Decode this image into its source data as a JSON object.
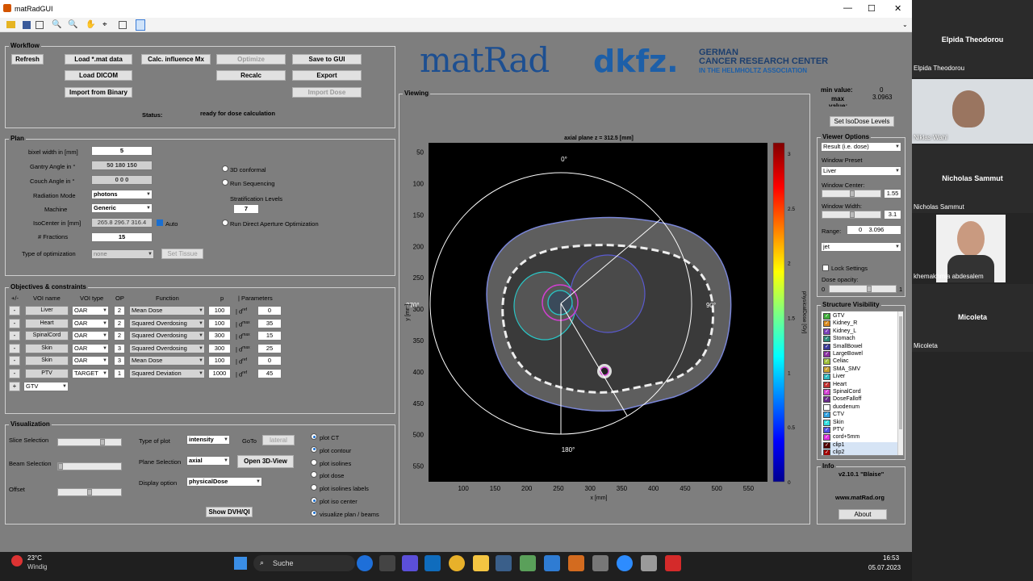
{
  "window": {
    "title": "matRadGUI",
    "minimize": "—",
    "maximize": "☐",
    "close": "✕"
  },
  "toolbar": {
    "icons": [
      "open-file-icon",
      "save-icon",
      "print-icon",
      "zoom-in-icon",
      "zoom-out-icon",
      "pan-icon",
      "data-cursor-icon",
      "grid-icon",
      "window-icon"
    ]
  },
  "workflow": {
    "title": "Workflow",
    "refresh": "Refresh",
    "load_mat": "Load *.mat data",
    "calc_influence": "Calc. influence Mx",
    "optimize": "Optimize",
    "save_gui": "Save to GUI",
    "load_dicom": "Load DICOM",
    "recalc": "Recalc",
    "export": "Export",
    "import_binary": "Import from Binary",
    "import_dose": "Import Dose",
    "status_label": "Status:",
    "status_value": "ready for dose calculation"
  },
  "logos": {
    "matrad": "matRad",
    "dkfz": "dkfz.",
    "dkfz_line1": "GERMAN",
    "dkfz_line2": "CANCER RESEARCH CENTER",
    "dkfz_line3": "IN THE HELMHOLTZ ASSOCIATION"
  },
  "plan": {
    "title": "Plan",
    "bixel_label": "bixel width in [mm]",
    "bixel_value": "5",
    "gantry_label": "Gantry Angle in °",
    "gantry_value": "50 180 150",
    "couch_label": "Couch Angle in °",
    "couch_value": "0 0 0",
    "radiation_label": "Radiation Mode",
    "radiation_value": "photons",
    "machine_label": "Machine",
    "machine_value": "Generic",
    "iso_label": "IsoCenter in [mm]",
    "iso_value": "265.8 296.7 316.4",
    "auto_label": "Auto",
    "fractions_label": "# Fractions",
    "fractions_value": "15",
    "opt_label": "Type of optimization",
    "opt_value": "none",
    "set_tissue": "Set Tissue",
    "conformal": "3D conformal",
    "sequencing": "Run Sequencing",
    "strat_label": "Stratification Levels",
    "strat_value": "7",
    "daopt": "Run Direct Aperture Optimization"
  },
  "objectives": {
    "title": "Objectives & constraints",
    "headers": {
      "pm": "+/-",
      "voi": "VOI name",
      "type": "VOI type",
      "op": "OP",
      "func": "Function",
      "p": "p",
      "params": "| Parameters"
    },
    "rows": [
      {
        "voi": "Liver",
        "type": "OAR",
        "op": "2",
        "func": "Mean Dose",
        "p": "100",
        "pl": "| d",
        "sup": "ref",
        "val": "0"
      },
      {
        "voi": "Heart",
        "type": "OAR",
        "op": "2",
        "func": "Squared Overdosing",
        "p": "100",
        "pl": "| d",
        "sup": "max",
        "val": "35"
      },
      {
        "voi": "SpinalCord",
        "type": "OAR",
        "op": "2",
        "func": "Squared Overdosing",
        "p": "300",
        "pl": "| d",
        "sup": "max",
        "val": "15"
      },
      {
        "voi": "Skin",
        "type": "OAR",
        "op": "3",
        "func": "Squared Overdosing",
        "p": "300",
        "pl": "| d",
        "sup": "max",
        "val": "25"
      },
      {
        "voi": "Skin",
        "type": "OAR",
        "op": "3",
        "func": "Mean Dose",
        "p": "100",
        "pl": "| d",
        "sup": "ref",
        "val": "0"
      },
      {
        "voi": "PTV",
        "type": "TARGET",
        "op": "1",
        "func": "Squared Deviation",
        "p": "1000",
        "pl": "| d",
        "sup": "ref",
        "val": "45"
      }
    ],
    "minus": "-",
    "plus": "+",
    "add_voi": "GTV"
  },
  "visualization": {
    "title": "Visualization",
    "slice_sel": "Slice Selection",
    "beam_sel": "Beam Selection",
    "offset": "Offset",
    "type_plot_label": "Type of plot",
    "type_plot_value": "intensity",
    "goto_label": "GoTo",
    "goto_value": "lateral",
    "plane_label": "Plane Selection",
    "plane_value": "axial",
    "open3d": "Open 3D-View",
    "display_label": "Display option",
    "display_value": "physicalDose",
    "show_dvh": "Show DVH/QI",
    "radios": [
      "plot CT",
      "plot contour",
      "plot isolines",
      "plot dose",
      "plot isolines labels",
      "plot iso center",
      "visualize plan / beams"
    ],
    "radio_on": [
      true,
      true,
      false,
      false,
      false,
      true,
      true
    ]
  },
  "viewing": {
    "title": "Viewing",
    "plot_title": "axial plane z = 312.5 [mm]",
    "xlabel": "x [mm]",
    "ylabel": "y [mm]",
    "xticks": [
      "100",
      "150",
      "200",
      "250",
      "300",
      "350",
      "400",
      "450",
      "500",
      "550"
    ],
    "yticks": [
      "50",
      "100",
      "150",
      "200",
      "250",
      "300",
      "350",
      "400",
      "450",
      "500",
      "550"
    ],
    "angle_0": "0°",
    "angle_90": "90°",
    "angle_180": "180°",
    "angle_270": "270°",
    "cbar_label": "physicalDose [Gy]",
    "cbar_ticks": [
      "3",
      "2.5",
      "2",
      "1.5",
      "1",
      "0.5",
      "0"
    ]
  },
  "minmax": {
    "min_label": "min value:",
    "min_value": "0",
    "max_label": "max",
    "max_value": "3.0963",
    "value_label": "value:",
    "set_iso": "Set IsoDose Levels"
  },
  "viewer_options": {
    "title": "Viewer Options",
    "result": "Result (i.e. dose)",
    "preset_label": "Window Preset",
    "preset_value": "Liver",
    "center_label": "Window Center:",
    "center_value": "1.55",
    "width_label": "Window Width:",
    "width_value": "3.1",
    "range_label": "Range:",
    "range_min": "0",
    "range_max": "3.096",
    "colormap": "jet",
    "lock": "Lock Settings",
    "opacity_label": "Dose opacity:",
    "opacity_min": "0",
    "opacity_max": "1"
  },
  "structures": {
    "title": "Structure Visibility",
    "items": [
      {
        "name": "GTV",
        "color": "#3fae3a"
      },
      {
        "name": "Kidney_R",
        "color": "#d98a1f"
      },
      {
        "name": "Kidney_L",
        "color": "#7a3fb8"
      },
      {
        "name": "Stomach",
        "color": "#2f8a7a"
      },
      {
        "name": "SmallBowel",
        "color": "#3a3a9a"
      },
      {
        "name": "LargeBowel",
        "color": "#8a2fa0"
      },
      {
        "name": "Celiac",
        "color": "#a0c03a"
      },
      {
        "name": "SMA_SMV",
        "color": "#c8a030"
      },
      {
        "name": "Liver",
        "color": "#30b8c0"
      },
      {
        "name": "Heart",
        "color": "#c03030"
      },
      {
        "name": "SpinalCord",
        "color": "#d040d0"
      },
      {
        "name": "DoseFalloff",
        "color": "#6a2a8a"
      },
      {
        "name": "duodenum",
        "color": "#ffffff"
      },
      {
        "name": "CTV",
        "color": "#30a0e0"
      },
      {
        "name": "Skin",
        "color": "#30e0e0"
      },
      {
        "name": "PTV",
        "color": "#5050e0"
      },
      {
        "name": "cord+5mm",
        "color": "#e030e0"
      },
      {
        "name": "clip1",
        "color": "#500000"
      },
      {
        "name": "clip2",
        "color": "#a00000"
      }
    ]
  },
  "info": {
    "title": "Info",
    "version": "v2.10.1 \"Blaise\"",
    "url": "www.matRad.org",
    "about": "About"
  },
  "taskbar": {
    "temp": "23°C",
    "weather": "Windig",
    "search": "Suche",
    "time": "16:53",
    "date": "05.07.2023"
  },
  "video": {
    "p1_name": "Elpida Theodorou",
    "p1_sub": "Elpida Theodorou",
    "p2_sub": "Niklas Wahl",
    "p3_name": "Nicholas Sammut",
    "p3_sub": "Nicholas Sammut",
    "p4_sub": "khemakhmia abdesalem",
    "p5_name": "Micoleta",
    "p5_sub": "Micoleta"
  }
}
